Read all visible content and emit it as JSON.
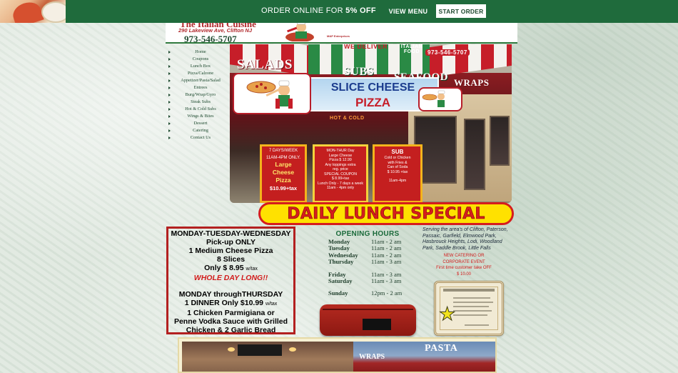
{
  "promo_bar": {
    "text_prefix": "ORDER ONLINE FOR ",
    "text_discount": "5% OFF",
    "view_menu_label": "VIEW MENU",
    "start_order_label": "START ORDER",
    "bg_color": "#1f6b3c"
  },
  "header": {
    "name": "The Italian Cuisine",
    "address": "290 Lakeview Ave, Clifton NJ",
    "phone": "973-546-5707",
    "credit": "M&P Enterprises"
  },
  "nav": {
    "items": [
      {
        "label": "Home"
      },
      {
        "label": "Coupons"
      },
      {
        "label": "Lunch Box"
      },
      {
        "label": "Pizza/Calzone"
      },
      {
        "label": "Appetizer/Pasta/Salad"
      },
      {
        "label": "Entrees"
      },
      {
        "label": "Burg/Wrap/Gyro"
      },
      {
        "label": "Steak Subs"
      },
      {
        "label": "Hot & Cold Subs"
      },
      {
        "label": "Wings & Bites"
      },
      {
        "label": "Dessert"
      },
      {
        "label": "Catering"
      },
      {
        "label": "Contact Us"
      }
    ]
  },
  "hero": {
    "awning_salads": "SALADS",
    "awning_subs": "SUBS",
    "awning_seafood": "SEAFOOD",
    "awning_wraps": "WRAPS",
    "we_deliver": "WE DELIVER",
    "italian_food": "ITALIAN FOOD",
    "sign_phone": "973-546-5707",
    "sign_line1": "SLICE CHEESE",
    "sign_line2": "PIZZA",
    "hot_cold": "HOT & COLD",
    "card1": {
      "title": "7 DAYS/WEEK",
      "subtitle": "11AM-4PM ONLY.",
      "big1": "Large",
      "big2": "Cheese",
      "big3": "Pizza",
      "price": "$10.99+tax"
    },
    "card2": {
      "line1": "MON-THUR Day",
      "line2": "Large Cheese",
      "line3": "Pizza $ 12.99",
      "line4": "Any toppings extra",
      "line5": "reg. price",
      "line6": "SPECIAL COUPON",
      "line7": "$ 8.99+tax",
      "line8": "Lunch Only - 7 days a week",
      "line9": "11am - 4pm only"
    },
    "card3": {
      "head": "SUB",
      "line1": "Cold or Chicken",
      "line2": "with Fries &",
      "line3": "Can of Soda",
      "line4": "$ 10.95 +tax",
      "line5": "11am-4pm"
    }
  },
  "daily_lunch_special": "DAILY LUNCH SPECIAL",
  "specials": {
    "l1": "MONDAY-TUESDAY-WEDNESDAY",
    "l2": "Pick-up ONLY",
    "l3": "1 Medium Cheese Pizza",
    "l4": "8 Slices",
    "l5": "Only $ 8.95",
    "l5_tax": "w/tax",
    "l6": "WHOLE DAY LONG!!",
    "l7": "MONDAY throughTHURSDAY",
    "l8": "1 DINNER  Only $10.99",
    "l8_tax": "w/tax",
    "l9": "1 Chicken Parmigiana or",
    "l10": "Penne Vodka Sauce with Grilled",
    "l11": "Chicken & 2 Garlic Bread"
  },
  "hours": {
    "title": "OPENING HOURS",
    "rows": [
      {
        "day": "Monday",
        "time": "11am - 2 am"
      },
      {
        "day": "Tuesday",
        "time": "11am - 2 am"
      },
      {
        "day": "Wednesday",
        "time": "11am - 2 am"
      },
      {
        "day": "Thursday",
        "time": "11am - 3 am"
      },
      {
        "day": "Friday",
        "time": "11am - 3 am"
      },
      {
        "day": "Saturday",
        "time": "11am - 3 am"
      },
      {
        "day": "Sunday",
        "time": "12pm - 2 am"
      }
    ]
  },
  "service_area": "Serving the area's of Clifton, Paterson, Passaic, Garfield, Elmwood Park, Hasbrouck Heights, Lodi, Woodland Park, Saddle Brook, Little Falls",
  "catering": {
    "line1": "NEW CATERING OR",
    "line2": "CORPORATE EVENT",
    "line3": "First time customer take OFF",
    "line4": "$ 10.00"
  },
  "bottom": {
    "wraps": "WRAPS",
    "pasta": "PASTA"
  }
}
